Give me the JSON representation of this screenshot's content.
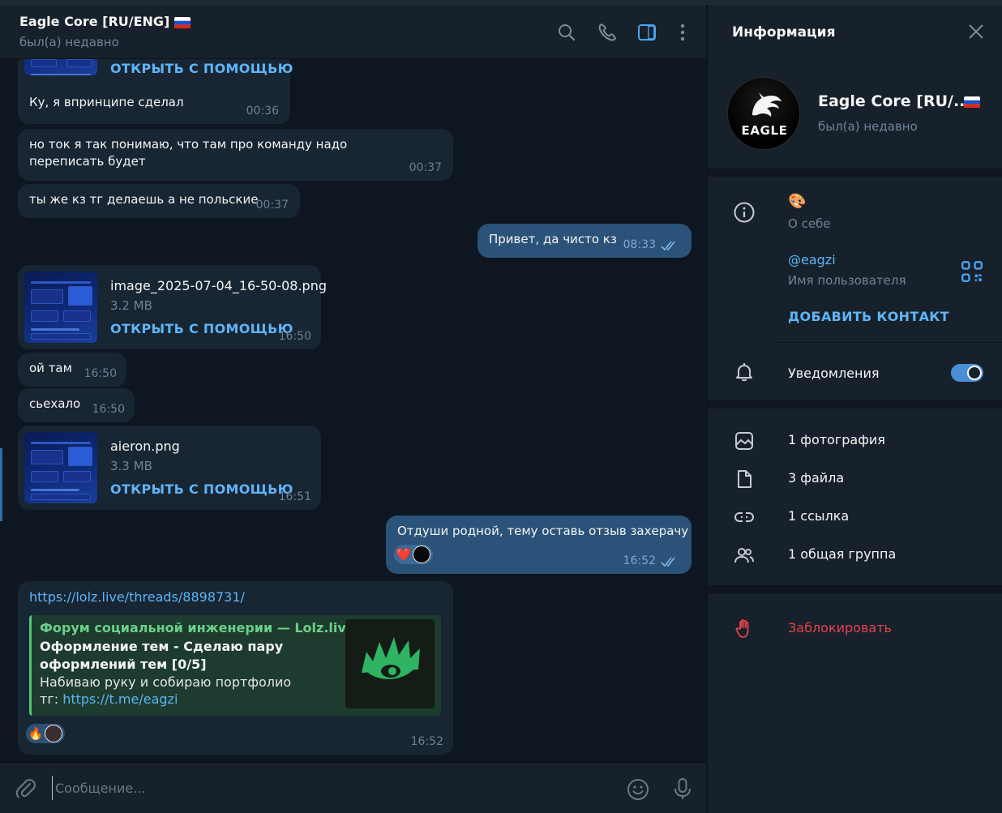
{
  "header": {
    "title": "Eagle Core [RU/ENG]",
    "status": "был(а) недавно"
  },
  "messages": {
    "m0": {
      "open": "ОТКРЫТЬ С ПОМОЩЬЮ",
      "text": "Ку, я впринципе сделал",
      "time": "00:36"
    },
    "m1": {
      "text": "но ток я так понимаю, что там про команду надо переписать будет",
      "time": "00:37"
    },
    "m2": {
      "text": "ты же кз тг делаешь а не польские",
      "time": "00:37"
    },
    "m3": {
      "text": "Привет, да чисто кз",
      "time": "08:33"
    },
    "m4": {
      "file_name": "image_2025-07-04_16-50-08.png",
      "file_size": "3.2 MB",
      "open": "ОТКРЫТЬ С ПОМОЩЬЮ",
      "time": "16:50"
    },
    "m5": {
      "text": "ой там",
      "time": "16:50"
    },
    "m6": {
      "text": "сьехало",
      "time": "16:50"
    },
    "m7": {
      "file_name": "aieron.png",
      "file_size": "3.3 MB",
      "open": "ОТКРЫТЬ С ПОМОЩЬЮ",
      "time": "16:51"
    },
    "m8": {
      "text": "Отдуши родной, тему оставь отзыв захерачу",
      "time": "16:52",
      "reaction": "❤️"
    },
    "m9": {
      "url": "https://lolz.live/threads/8898731/",
      "preview_site": "Форум социальной инженерии — Lolz.live (...",
      "preview_title": "Оформление тем - Сделаю пару оформлений тем [0/5]",
      "preview_desc": "Набиваю руку и собираю портфолио",
      "preview_tg_prefix": "тг: ",
      "preview_tg_link": "https://t.me/eagzi",
      "reaction": "🔥",
      "time": "16:52"
    }
  },
  "composer": {
    "placeholder": "Сообщение..."
  },
  "info": {
    "title": "Информация",
    "name": "Eagle Core [RU/...",
    "status": "был(а) недавно",
    "avatar_text": "EAGLE",
    "bio_emoji": "🎨",
    "bio_label": "О себе",
    "username": "@eagzi",
    "username_label": "Имя пользователя",
    "add_contact": "ДОБАВИТЬ КОНТАКТ",
    "notifications": "Уведомления",
    "notifications_on": true,
    "photos": "1 фотография",
    "files": "3 файла",
    "links": "1 ссылка",
    "groups": "1 общая группа",
    "block": "Заблокировать"
  },
  "colors": {
    "background": "#0e1621",
    "panel": "#17212b",
    "incoming_bubble": "#182533",
    "outgoing_bubble": "#2b5278",
    "accent": "#5eb5f7",
    "danger": "#e5434d",
    "preview_accent": "#50c878"
  },
  "icons": [
    "search-icon",
    "phone-icon",
    "sidebar-toggle-icon",
    "more-icon",
    "close-icon",
    "info-icon",
    "qr-code-icon",
    "bell-icon",
    "photo-icon",
    "file-icon",
    "link-icon",
    "group-icon",
    "hand-icon",
    "attach-icon",
    "emoji-icon",
    "microphone-icon",
    "double-check-icon"
  ]
}
